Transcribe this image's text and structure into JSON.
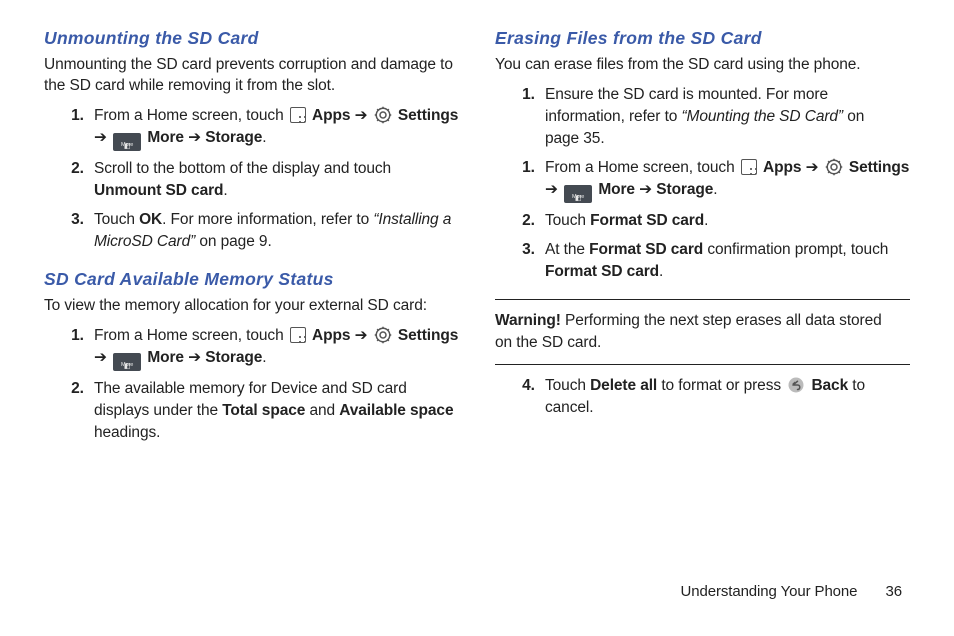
{
  "left": {
    "section1": {
      "heading": "Unmounting the SD Card",
      "intro": "Unmounting the SD card prevents corruption and damage to the SD card while removing it from the slot.",
      "steps": {
        "s1a": "From a Home screen, touch ",
        "apps": "Apps",
        "arrow": " ➔ ",
        "settings": "Settings",
        "more": "More",
        "storage": "Storage",
        "s2a": "Scroll to the bottom of the display and touch ",
        "s2b": "Unmount SD card",
        "s3a": "Touch ",
        "ok": "OK",
        "s3b": ". For more information, refer to ",
        "s3ref": "“Installing a MicroSD Card”",
        "s3c": " on page 9."
      }
    },
    "section2": {
      "heading": "SD Card Available Memory Status",
      "intro": "To view the memory allocation for your external SD card:",
      "steps": {
        "s2a": "The available memory for Device and SD card displays under the ",
        "total": "Total space",
        "and": " and ",
        "avail": "Available space",
        "s2b": " headings."
      }
    }
  },
  "right": {
    "section1": {
      "heading": "Erasing Files from the SD Card",
      "intro": "You can erase files from the SD card using the phone.",
      "steps": {
        "s1a": "Ensure the SD card is mounted. For more information, refer to ",
        "s1ref": "“Mounting the SD Card”",
        "s1b": " on page 35.",
        "s2a": "Touch ",
        "format": "Format SD card",
        "s3a": "At the ",
        "s3b": " confirmation prompt, touch ",
        "s4a": "Touch ",
        "deleteall": "Delete all",
        "s4b": " to format or press ",
        "back": "Back",
        "s4c": " to cancel."
      }
    },
    "warning": {
      "label": "Warning!",
      "text": " Performing the next step erases all data stored on the SD card."
    }
  },
  "icons": {
    "more_label": "More"
  },
  "footer": {
    "section": "Understanding Your Phone",
    "page": "36"
  }
}
